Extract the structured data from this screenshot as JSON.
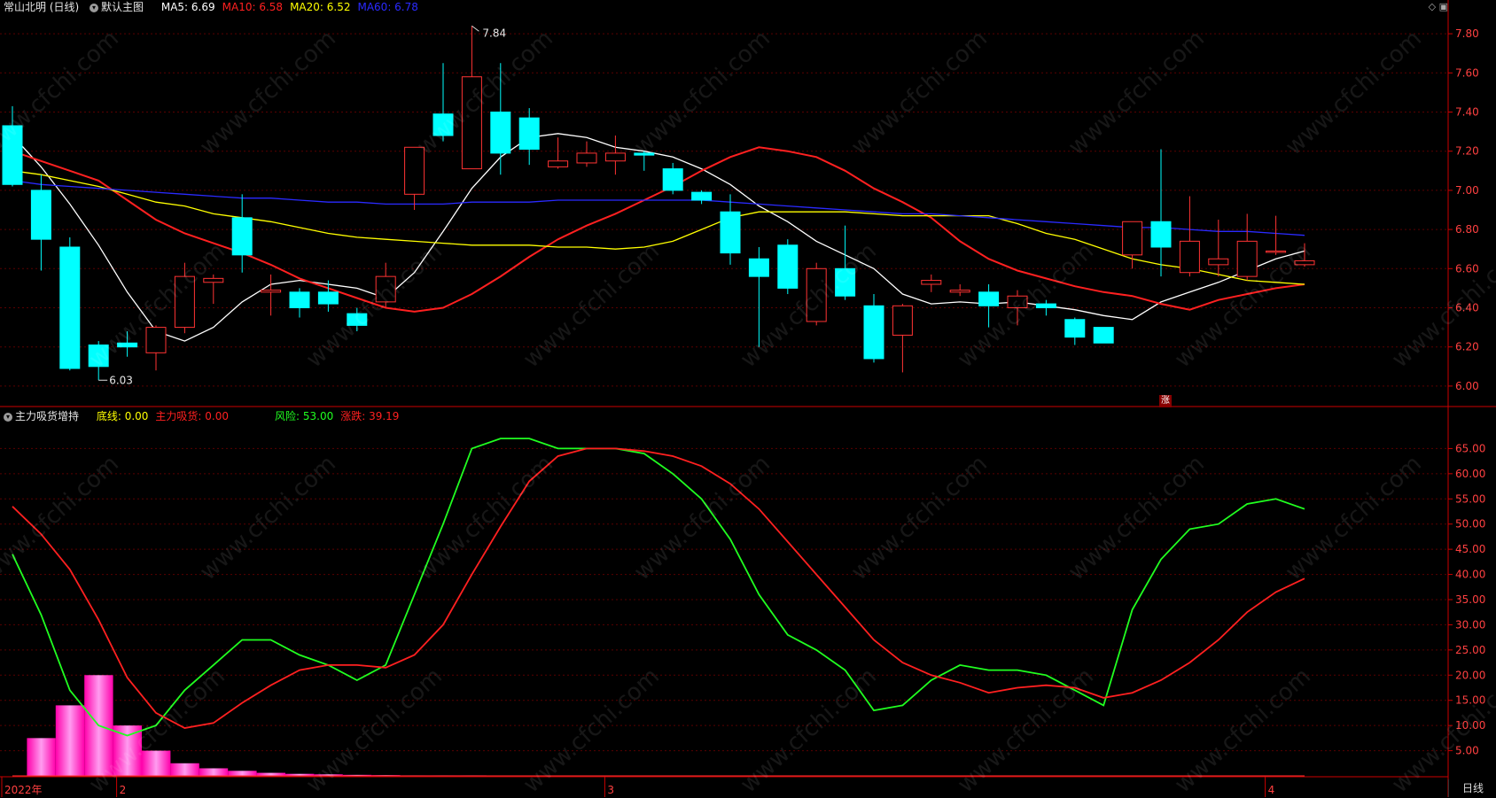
{
  "header": {
    "stock_title": "常山北明 (日线)",
    "template": "默认主图",
    "ma": [
      {
        "label": "MA5: 6.69",
        "color": "#ffffff"
      },
      {
        "label": "MA10: 6.58",
        "color": "#ff2020"
      },
      {
        "label": "MA20: 6.52",
        "color": "#ffff00"
      },
      {
        "label": "MA60: 6.78",
        "color": "#2a2aff"
      }
    ]
  },
  "indicator_header": {
    "name": "主力吸货增持",
    "items": [
      {
        "label": "底线: 0.00",
        "color": "#ffff00"
      },
      {
        "label": "主力吸货: 0.00",
        "color": "#ff2020"
      },
      {
        "label": "风险: 53.00",
        "color": "#20ff20"
      },
      {
        "label": "涨跌: 39.19",
        "color": "#ff2020"
      }
    ]
  },
  "annotations": {
    "high": "7.84",
    "low": "6.03",
    "zhang": "涨"
  },
  "x_axis_labels": [
    {
      "label": "2022年",
      "index": 0
    },
    {
      "label": "2",
      "index": 4
    },
    {
      "label": "3",
      "index": 21
    },
    {
      "label": "4",
      "index": 44
    }
  ],
  "period_tab": "日线",
  "watermark": "www.cfchi.com",
  "colors": {
    "up": "#ff3333",
    "down": "#00ffff",
    "grid": "#5a0000",
    "axis": "#cc0000"
  },
  "chart_data": [
    {
      "type": "candlestick",
      "ylim": [
        5.9,
        7.9
      ],
      "y_ticks": [
        "6.00",
        "6.20",
        "6.40",
        "6.60",
        "6.80",
        "7.00",
        "7.20",
        "7.40",
        "7.60",
        "7.80"
      ],
      "grid": true,
      "candles": [
        {
          "o": 7.33,
          "h": 7.43,
          "l": 7.02,
          "c": 7.03
        },
        {
          "o": 7.0,
          "h": 7.08,
          "l": 6.59,
          "c": 6.75
        },
        {
          "o": 6.71,
          "h": 6.76,
          "l": 6.08,
          "c": 6.09
        },
        {
          "o": 6.21,
          "h": 6.23,
          "l": 6.03,
          "c": 6.1
        },
        {
          "o": 6.22,
          "h": 6.28,
          "l": 6.15,
          "c": 6.2
        },
        {
          "o": 6.17,
          "h": 6.31,
          "l": 6.08,
          "c": 6.3
        },
        {
          "o": 6.3,
          "h": 6.63,
          "l": 6.27,
          "c": 6.56
        },
        {
          "o": 6.53,
          "h": 6.57,
          "l": 6.42,
          "c": 6.55
        },
        {
          "o": 6.86,
          "h": 6.98,
          "l": 6.58,
          "c": 6.67
        },
        {
          "o": 6.48,
          "h": 6.57,
          "l": 6.36,
          "c": 6.49
        },
        {
          "o": 6.48,
          "h": 6.5,
          "l": 6.35,
          "c": 6.4
        },
        {
          "o": 6.48,
          "h": 6.54,
          "l": 6.38,
          "c": 6.42
        },
        {
          "o": 6.37,
          "h": 6.4,
          "l": 6.28,
          "c": 6.31
        },
        {
          "o": 6.43,
          "h": 6.63,
          "l": 6.4,
          "c": 6.56
        },
        {
          "o": 6.98,
          "h": 7.22,
          "l": 6.9,
          "c": 7.22
        },
        {
          "o": 7.39,
          "h": 7.65,
          "l": 7.25,
          "c": 7.28
        },
        {
          "o": 7.11,
          "h": 7.84,
          "l": 7.11,
          "c": 7.58
        },
        {
          "o": 7.4,
          "h": 7.65,
          "l": 7.08,
          "c": 7.19
        },
        {
          "o": 7.37,
          "h": 7.42,
          "l": 7.13,
          "c": 7.21
        },
        {
          "o": 7.12,
          "h": 7.27,
          "l": 7.11,
          "c": 7.15
        },
        {
          "o": 7.14,
          "h": 7.25,
          "l": 7.12,
          "c": 7.19
        },
        {
          "o": 7.15,
          "h": 7.28,
          "l": 7.08,
          "c": 7.19
        },
        {
          "o": 7.19,
          "h": 7.2,
          "l": 7.1,
          "c": 7.18
        },
        {
          "o": 7.11,
          "h": 7.14,
          "l": 6.98,
          "c": 7.0
        },
        {
          "o": 6.99,
          "h": 7.0,
          "l": 6.93,
          "c": 6.95
        },
        {
          "o": 6.89,
          "h": 6.98,
          "l": 6.62,
          "c": 6.68
        },
        {
          "o": 6.65,
          "h": 6.71,
          "l": 6.2,
          "c": 6.56
        },
        {
          "o": 6.72,
          "h": 6.75,
          "l": 6.47,
          "c": 6.5
        },
        {
          "o": 6.33,
          "h": 6.63,
          "l": 6.31,
          "c": 6.6
        },
        {
          "o": 6.6,
          "h": 6.82,
          "l": 6.44,
          "c": 6.46
        },
        {
          "o": 6.41,
          "h": 6.47,
          "l": 6.12,
          "c": 6.14
        },
        {
          "o": 6.26,
          "h": 6.42,
          "l": 6.07,
          "c": 6.41
        },
        {
          "o": 6.52,
          "h": 6.57,
          "l": 6.48,
          "c": 6.54
        },
        {
          "o": 6.48,
          "h": 6.52,
          "l": 6.46,
          "c": 6.49
        },
        {
          "o": 6.48,
          "h": 6.52,
          "l": 6.3,
          "c": 6.41
        },
        {
          "o": 6.4,
          "h": 6.49,
          "l": 6.31,
          "c": 6.46
        },
        {
          "o": 6.42,
          "h": 6.44,
          "l": 6.36,
          "c": 6.4
        },
        {
          "o": 6.34,
          "h": 6.35,
          "l": 6.21,
          "c": 6.25
        },
        {
          "o": 6.3,
          "h": 6.3,
          "l": 6.22,
          "c": 6.22
        },
        {
          "o": 6.67,
          "h": 6.84,
          "l": 6.6,
          "c": 6.84
        },
        {
          "o": 6.84,
          "h": 7.21,
          "l": 6.56,
          "c": 6.71
        },
        {
          "o": 6.58,
          "h": 6.97,
          "l": 6.56,
          "c": 6.74
        },
        {
          "o": 6.62,
          "h": 6.85,
          "l": 6.56,
          "c": 6.65
        },
        {
          "o": 6.56,
          "h": 6.88,
          "l": 6.54,
          "c": 6.74
        },
        {
          "o": 6.69,
          "h": 6.87,
          "l": 6.67,
          "c": 6.69
        },
        {
          "o": 6.62,
          "h": 6.73,
          "l": 6.61,
          "c": 6.64
        }
      ],
      "series": [
        {
          "name": "MA5",
          "color": "#ffffff",
          "values": [
            7.28,
            7.12,
            6.93,
            6.72,
            6.48,
            6.28,
            6.23,
            6.3,
            6.43,
            6.52,
            6.54,
            6.52,
            6.5,
            6.45,
            6.58,
            6.79,
            7.01,
            7.17,
            7.27,
            7.29,
            7.27,
            7.22,
            7.2,
            7.17,
            7.11,
            7.03,
            6.92,
            6.84,
            6.74,
            6.67,
            6.6,
            6.47,
            6.42,
            6.43,
            6.42,
            6.43,
            6.41,
            6.39,
            6.36,
            6.34,
            6.43,
            6.48,
            6.53,
            6.59,
            6.65,
            6.69
          ]
        },
        {
          "name": "MA10",
          "color": "#ff2020",
          "values": [
            7.2,
            7.15,
            7.1,
            7.05,
            6.95,
            6.85,
            6.78,
            6.73,
            6.68,
            6.62,
            6.55,
            6.5,
            6.45,
            6.4,
            6.38,
            6.4,
            6.47,
            6.56,
            6.66,
            6.75,
            6.82,
            6.88,
            6.95,
            7.02,
            7.1,
            7.17,
            7.22,
            7.2,
            7.17,
            7.1,
            7.01,
            6.94,
            6.86,
            6.74,
            6.65,
            6.59,
            6.55,
            6.51,
            6.48,
            6.46,
            6.42,
            6.39,
            6.44,
            6.47,
            6.5,
            6.52
          ]
        },
        {
          "name": "MA20",
          "color": "#ffff00",
          "values": [
            7.1,
            7.08,
            7.05,
            7.02,
            6.98,
            6.94,
            6.92,
            6.88,
            6.86,
            6.84,
            6.81,
            6.78,
            6.76,
            6.75,
            6.74,
            6.73,
            6.72,
            6.72,
            6.72,
            6.71,
            6.71,
            6.7,
            6.71,
            6.74,
            6.8,
            6.86,
            6.89,
            6.89,
            6.89,
            6.89,
            6.88,
            6.87,
            6.87,
            6.87,
            6.87,
            6.83,
            6.78,
            6.75,
            6.7,
            6.65,
            6.62,
            6.6,
            6.57,
            6.54,
            6.53,
            6.52
          ]
        },
        {
          "name": "MA60",
          "color": "#2a2aff",
          "values": [
            7.05,
            7.03,
            7.02,
            7.01,
            7.0,
            6.99,
            6.98,
            6.97,
            6.96,
            6.96,
            6.95,
            6.94,
            6.94,
            6.93,
            6.93,
            6.93,
            6.94,
            6.94,
            6.94,
            6.95,
            6.95,
            6.95,
            6.95,
            6.95,
            6.95,
            6.94,
            6.93,
            6.92,
            6.91,
            6.9,
            6.89,
            6.88,
            6.88,
            6.87,
            6.86,
            6.85,
            6.84,
            6.83,
            6.82,
            6.81,
            6.81,
            6.8,
            6.79,
            6.79,
            6.78,
            6.77
          ]
        }
      ]
    },
    {
      "type": "line",
      "ylim": [
        0,
        70
      ],
      "y_ticks": [
        "5.00",
        "10.00",
        "15.00",
        "20.00",
        "25.00",
        "30.00",
        "35.00",
        "40.00",
        "45.00",
        "50.00",
        "55.00",
        "60.00",
        "65.00"
      ],
      "grid": true,
      "series": [
        {
          "name": "风险",
          "color": "#20ff20",
          "values": [
            44,
            32,
            17,
            10,
            8,
            10,
            17,
            22,
            27,
            27,
            24,
            22,
            19,
            22,
            36,
            50,
            65,
            67,
            67,
            65,
            65,
            65,
            64,
            60,
            55,
            47,
            36,
            28,
            25,
            21,
            13,
            14,
            19,
            22,
            21,
            21,
            20,
            17,
            14,
            33,
            43,
            49,
            50,
            54,
            55,
            53
          ]
        },
        {
          "name": "涨跌",
          "color": "#ff2020",
          "values": [
            53.5,
            48,
            41,
            31,
            19.5,
            12.5,
            9.5,
            10.5,
            14.5,
            18,
            21,
            22,
            22,
            21.5,
            24,
            30,
            40,
            49.5,
            58.5,
            63.5,
            65,
            65,
            64.5,
            63.5,
            61.5,
            58,
            53,
            46.5,
            40,
            33.5,
            27,
            22.5,
            20,
            18.5,
            16.5,
            17.5,
            18,
            17.5,
            15.5,
            16.5,
            19,
            22.5,
            27,
            32.5,
            36.5,
            39.19
          ]
        },
        {
          "name": "主力吸货",
          "color": "#ff00ff",
          "type": "bar",
          "values": [
            0,
            7.5,
            14,
            20,
            10,
            5,
            2.5,
            1.5,
            1,
            0.6,
            0.4,
            0.3,
            0.2,
            0.15,
            0.1,
            0.1,
            0.1,
            0.05,
            0.05,
            0.05,
            0.05,
            0,
            0,
            0,
            0,
            0,
            0,
            0,
            0,
            0,
            0,
            0,
            0,
            0,
            0,
            0,
            0,
            0,
            0,
            0,
            0,
            0,
            0,
            0,
            0,
            0
          ]
        }
      ]
    }
  ]
}
